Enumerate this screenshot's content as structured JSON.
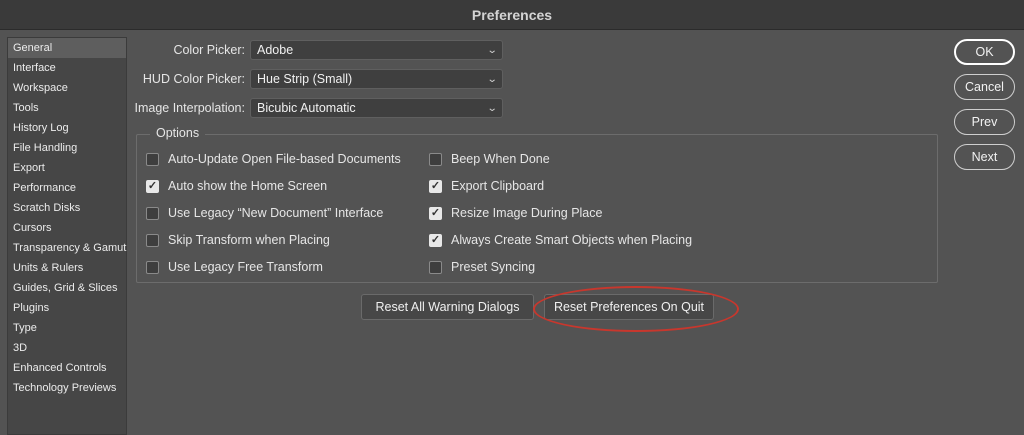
{
  "window": {
    "title": "Preferences"
  },
  "sidebar": {
    "items": [
      {
        "label": "General",
        "active": true
      },
      {
        "label": "Interface"
      },
      {
        "label": "Workspace"
      },
      {
        "label": "Tools"
      },
      {
        "label": "History Log"
      },
      {
        "label": "File Handling"
      },
      {
        "label": "Export"
      },
      {
        "label": "Performance"
      },
      {
        "label": "Scratch Disks"
      },
      {
        "label": "Cursors"
      },
      {
        "label": "Transparency & Gamut"
      },
      {
        "label": "Units & Rulers"
      },
      {
        "label": "Guides, Grid & Slices"
      },
      {
        "label": "Plugins"
      },
      {
        "label": "Type"
      },
      {
        "label": "3D"
      },
      {
        "label": "Enhanced Controls"
      },
      {
        "label": "Technology Previews"
      }
    ]
  },
  "fields": {
    "color_picker": {
      "label": "Color Picker:",
      "value": "Adobe"
    },
    "hud_color_picker": {
      "label": "HUD Color Picker:",
      "value": "Hue Strip (Small)"
    },
    "image_interpolation": {
      "label": "Image Interpolation:",
      "value": "Bicubic Automatic"
    }
  },
  "options": {
    "legend": "Options",
    "left": [
      {
        "label": "Auto-Update Open File-based Documents",
        "checked": false
      },
      {
        "label": "Auto show the Home Screen",
        "checked": true
      },
      {
        "label": "Use Legacy “New Document” Interface",
        "checked": false
      },
      {
        "label": "Skip Transform when Placing",
        "checked": false
      },
      {
        "label": "Use Legacy Free Transform",
        "checked": false
      }
    ],
    "right": [
      {
        "label": "Beep When Done",
        "checked": false
      },
      {
        "label": "Export Clipboard",
        "checked": true
      },
      {
        "label": "Resize Image During Place",
        "checked": true
      },
      {
        "label": "Always Create Smart Objects when Placing",
        "checked": true
      },
      {
        "label": "Preset Syncing",
        "checked": false
      }
    ]
  },
  "buttons": {
    "reset_warnings": "Reset All Warning Dialogs",
    "reset_prefs": "Reset Preferences On Quit",
    "ok": "OK",
    "cancel": "Cancel",
    "prev": "Prev",
    "next": "Next"
  },
  "icons": {
    "dropdown": "chevron-down-icon",
    "check": "checkmark-icon"
  },
  "colors": {
    "highlight": "#c8372d",
    "background": "#535353"
  }
}
